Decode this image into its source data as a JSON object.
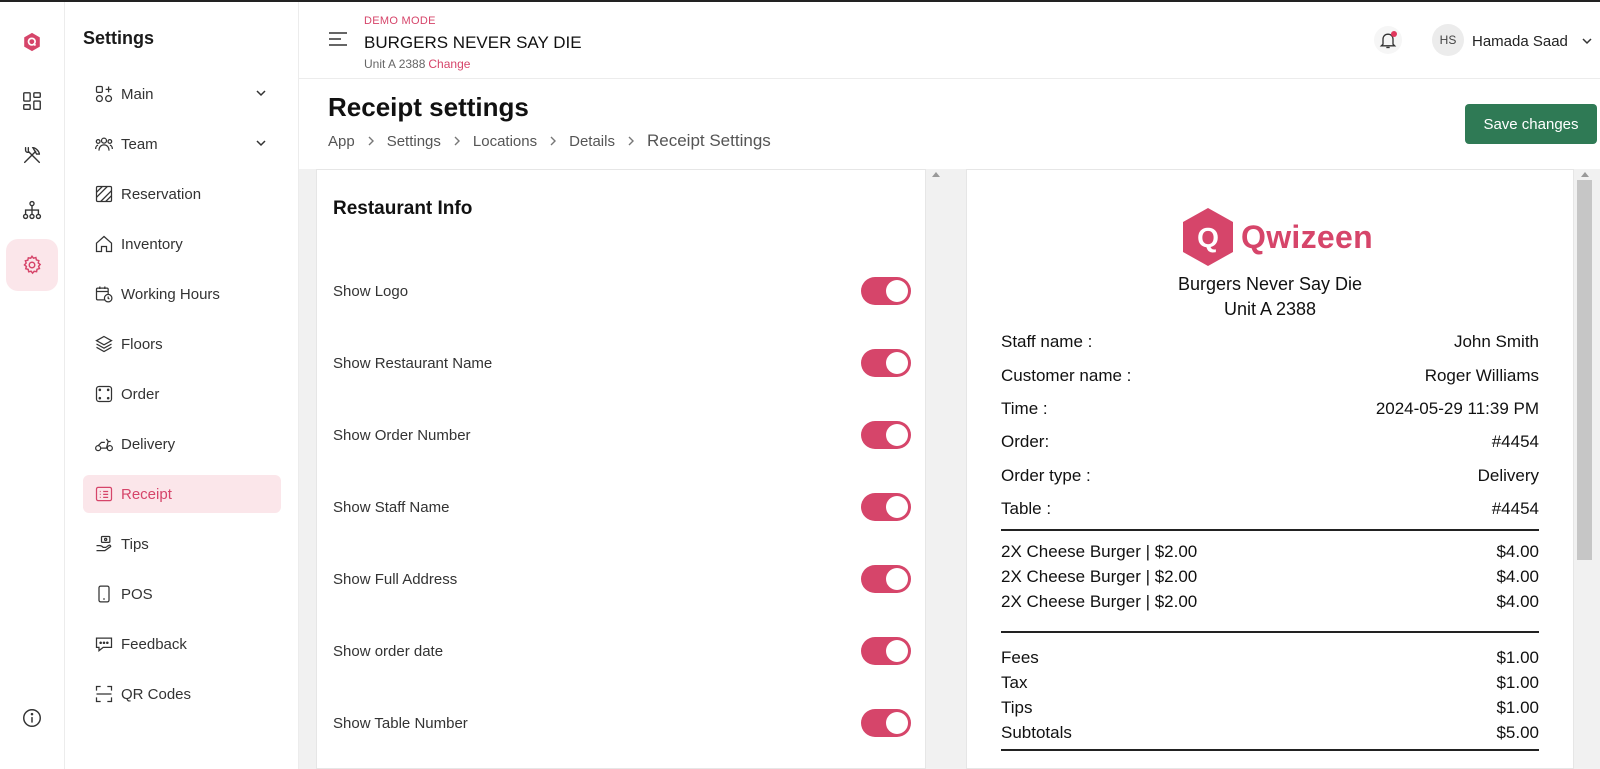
{
  "header": {
    "demo_mode": "DEMO MODE",
    "restaurant": "BURGERS NEVER SAY DIE",
    "unit": "Unit A 2388",
    "change": "Change",
    "avatar_initials": "HS",
    "user_name": "Hamada Saad"
  },
  "sidebar": {
    "title": "Settings",
    "items": [
      {
        "label": "Main",
        "icon": "grid-plus-icon",
        "chevron": true
      },
      {
        "label": "Team",
        "icon": "team-icon",
        "chevron": true
      },
      {
        "label": "Reservation",
        "icon": "reservation-icon"
      },
      {
        "label": "Inventory",
        "icon": "home-icon"
      },
      {
        "label": "Working Hours",
        "icon": "calendar-clock-icon"
      },
      {
        "label": "Floors",
        "icon": "layers-icon"
      },
      {
        "label": "Order",
        "icon": "order-icon"
      },
      {
        "label": "Delivery",
        "icon": "scooter-icon"
      },
      {
        "label": "Receipt",
        "icon": "receipt-icon",
        "active": true
      },
      {
        "label": "Tips",
        "icon": "tips-hand-icon"
      },
      {
        "label": "POS",
        "icon": "mobile-icon"
      },
      {
        "label": "Feedback",
        "icon": "feedback-icon"
      },
      {
        "label": "QR Codes",
        "icon": "qr-scan-icon"
      }
    ]
  },
  "page": {
    "title": "Receipt settings",
    "breadcrumbs": [
      "App",
      "Settings",
      "Locations",
      "Details",
      "Receipt Settings"
    ],
    "save_label": "Save changes"
  },
  "settings": {
    "title": "Restaurant Info",
    "toggles": [
      {
        "label": "Show Logo",
        "on": true
      },
      {
        "label": "Show Restaurant Name",
        "on": true
      },
      {
        "label": "Show Order Number",
        "on": true
      },
      {
        "label": "Show Staff Name",
        "on": true
      },
      {
        "label": "Show Full Address",
        "on": true
      },
      {
        "label": "Show order date",
        "on": true
      },
      {
        "label": "Show Table Number",
        "on": true
      }
    ]
  },
  "receipt": {
    "logo_letter": "Q",
    "logo_text": "Qwizeen",
    "restaurant_name": "Burgers Never Say Die",
    "unit": "Unit A 2388",
    "info": [
      {
        "label": "Staff name :",
        "value": "John Smith"
      },
      {
        "label": "Customer name :",
        "value": "Roger Williams"
      },
      {
        "label": "Time :",
        "value": "2024-05-29 11:39 PM"
      },
      {
        "label": "Order:",
        "value": "#4454"
      },
      {
        "label": "Order type :",
        "value": "Delivery"
      },
      {
        "label": "Table :",
        "value": "#4454"
      }
    ],
    "items": [
      {
        "label": "2X Cheese Burger | $2.00",
        "value": "$4.00"
      },
      {
        "label": "2X Cheese Burger | $2.00",
        "value": "$4.00"
      },
      {
        "label": "2X Cheese Burger | $2.00",
        "value": "$4.00"
      }
    ],
    "totals": [
      {
        "label": "Fees",
        "value": "$1.00"
      },
      {
        "label": "Tax",
        "value": "$1.00"
      },
      {
        "label": "Tips",
        "value": "$1.00"
      },
      {
        "label": "Subtotals",
        "value": "$5.00"
      }
    ]
  },
  "colors": {
    "accent": "#d6456a",
    "save_button": "#2f7a55",
    "active_bg": "#fbe6ea"
  }
}
